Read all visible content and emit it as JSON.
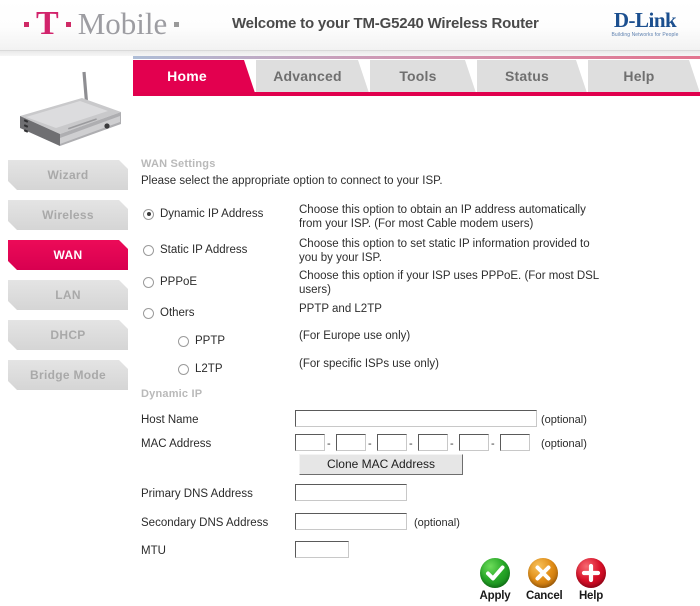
{
  "header": {
    "brand_t": "T",
    "brand_word": "Mobile",
    "welcome": "Welcome to your TM-G5240 Wireless Router",
    "vendor_name": "D-Link",
    "vendor_tagline": "Building Networks for People",
    "brand_color": "#d2246c",
    "vendor_color": "#1b4f8f"
  },
  "tabs": [
    {
      "label": "Home",
      "active": true
    },
    {
      "label": "Advanced",
      "active": false
    },
    {
      "label": "Tools",
      "active": false
    },
    {
      "label": "Status",
      "active": false
    },
    {
      "label": "Help",
      "active": false
    }
  ],
  "sidebar": {
    "device_image_alt": "router-illustration",
    "items": [
      {
        "label": "Wizard",
        "active": false
      },
      {
        "label": "Wireless",
        "active": false
      },
      {
        "label": "WAN",
        "active": true
      },
      {
        "label": "LAN",
        "active": false
      },
      {
        "label": "DHCP",
        "active": false
      },
      {
        "label": "Bridge Mode",
        "active": false
      }
    ],
    "active_color": "#e3004f"
  },
  "main": {
    "section_title": "WAN Settings",
    "section_subtitle": "Please select the appropriate option to connect to your ISP.",
    "connection_options": [
      {
        "label": "Dynamic IP Address",
        "selected": true,
        "description": "Choose this option to obtain an IP address automatically from your ISP. (For most Cable modem users)"
      },
      {
        "label": "Static IP Address",
        "selected": false,
        "description": "Choose this option to set static IP information provided to you by your ISP."
      },
      {
        "label": "PPPoE",
        "selected": false,
        "description": "Choose this option if your ISP uses PPPoE. (For most DSL users)"
      },
      {
        "label": "Others",
        "selected": false,
        "description": "PPTP and L2TP"
      }
    ],
    "sub_options": [
      {
        "label": "PPTP",
        "selected": false,
        "description": "(For Europe use only)"
      },
      {
        "label": "L2TP",
        "selected": false,
        "description": "(For specific ISPs use only)"
      }
    ],
    "dynamic_ip": {
      "title": "Dynamic IP",
      "host_name": {
        "label": "Host Name",
        "value": "",
        "note": "(optional)"
      },
      "mac_address": {
        "label": "MAC Address",
        "segments": [
          "",
          "",
          "",
          "",
          "",
          ""
        ],
        "separator": "-",
        "note": "(optional)"
      },
      "clone_button": "Clone MAC Address",
      "primary_dns": {
        "label": "Primary DNS Address",
        "value": ""
      },
      "secondary_dns": {
        "label": "Secondary DNS Address",
        "value": "",
        "note": "(optional)"
      },
      "mtu": {
        "label": "MTU",
        "value": ""
      }
    }
  },
  "actions": [
    {
      "label": "Apply",
      "icon": "check-circle-icon",
      "color": "#28a828"
    },
    {
      "label": "Cancel",
      "icon": "x-circle-icon",
      "color": "#e08c16"
    },
    {
      "label": "Help",
      "icon": "plus-circle-icon",
      "color": "#d81028"
    }
  ]
}
